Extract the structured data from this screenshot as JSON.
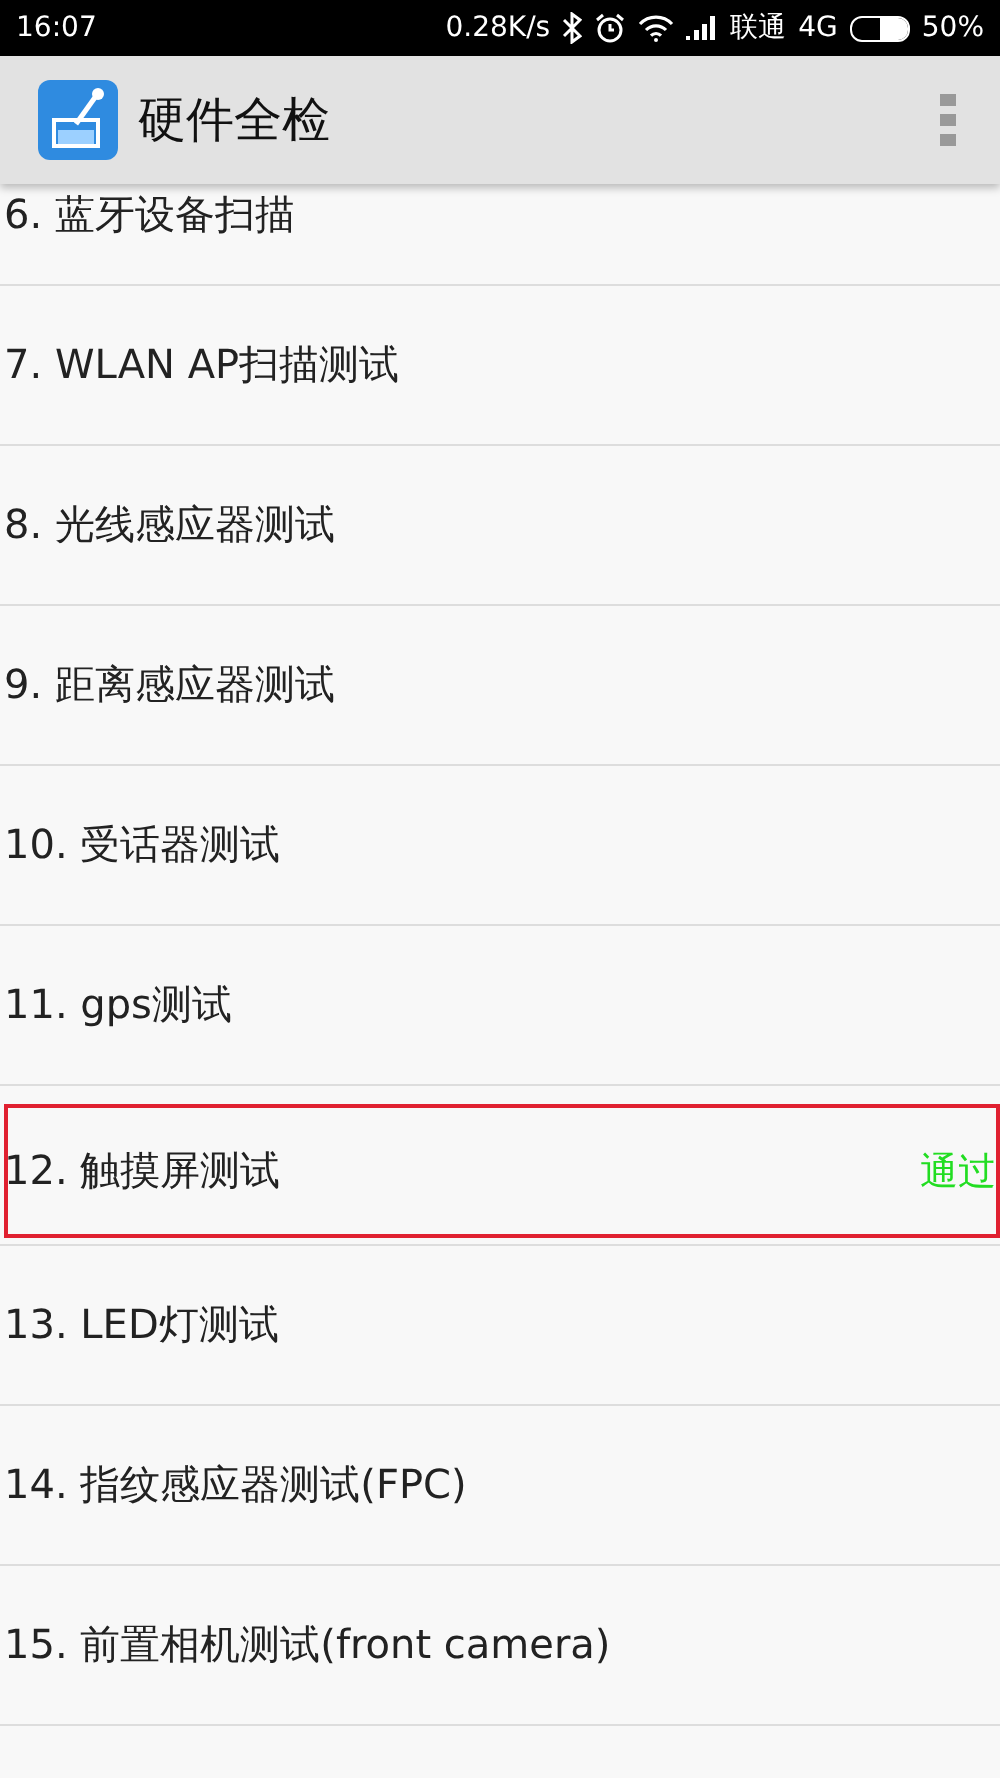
{
  "status_bar": {
    "time": "16:07",
    "speed": "0.28K/s",
    "carrier": "联通",
    "network": "4G",
    "battery": "50%",
    "battery_meter": {
      "level": 0.5
    }
  },
  "app_bar": {
    "title": "硬件全检"
  },
  "items": [
    {
      "label": "6. 蓝牙设备扫描",
      "selected": false
    },
    {
      "label": "7. WLAN AP扫描测试",
      "selected": false
    },
    {
      "label": "8. 光线感应器测试",
      "selected": false
    },
    {
      "label": "9. 距离感应器测试",
      "selected": false
    },
    {
      "label": "10. 受话器测试",
      "selected": false
    },
    {
      "label": "11. gps测试",
      "selected": false
    },
    {
      "label": "12. 触摸屏测试",
      "selected": true,
      "result": "通过",
      "color": "#22dd22"
    },
    {
      "label": "13. LED灯测试",
      "selected": false
    },
    {
      "label": "14. 指纹感应器测试(FPC)",
      "selected": false
    },
    {
      "label": "15. 前置相机测试(front camera)",
      "selected": false
    }
  ]
}
